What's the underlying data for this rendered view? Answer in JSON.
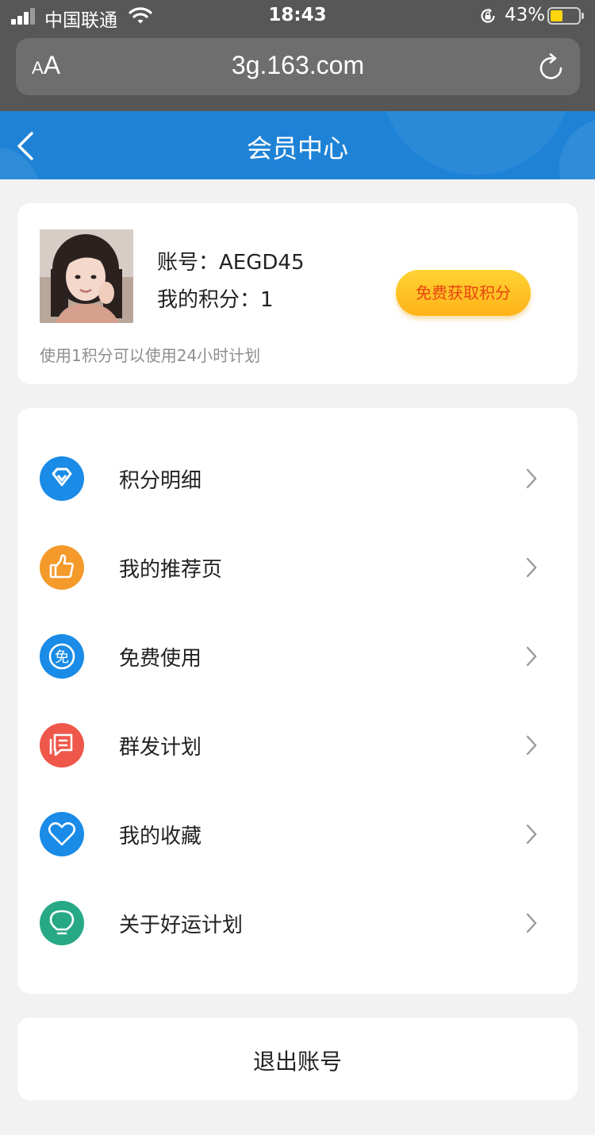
{
  "status_bar": {
    "carrier": "中国联通",
    "time": "18:43",
    "battery_percent": "43%",
    "battery_level": 0.43,
    "battery_color": "#ffd60a"
  },
  "browser": {
    "text_size_small": "A",
    "text_size_big": "A",
    "url": "3g.163.com",
    "reload_icon": "reload-icon"
  },
  "header": {
    "title": "会员中心",
    "back_icon": "chevron-left-icon",
    "color": "#1e83d6"
  },
  "profile": {
    "account_label": "账号：",
    "account_value": "AEGD45",
    "points_label": "我的积分：",
    "points_value": "1",
    "get_points_button": "免费获取积分",
    "hint": "使用1积分可以使用24小时计划"
  },
  "menu": {
    "items": [
      {
        "label": "积分明细",
        "icon": "diamond-icon",
        "color": "#1a8be6"
      },
      {
        "label": "我的推荐页",
        "icon": "thumbs-up-icon",
        "color": "#f39a2b"
      },
      {
        "label": "免费使用",
        "icon": "free-badge-icon",
        "color": "#1a8be6",
        "icon_text": "免"
      },
      {
        "label": "群发计划",
        "icon": "message-icon",
        "color": "#ee574a"
      },
      {
        "label": "我的收藏",
        "icon": "heart-icon",
        "color": "#1a8be6"
      },
      {
        "label": "关于好运计划",
        "icon": "lightbulb-icon",
        "color": "#27a985"
      }
    ]
  },
  "logout": {
    "label": "退出账号"
  }
}
